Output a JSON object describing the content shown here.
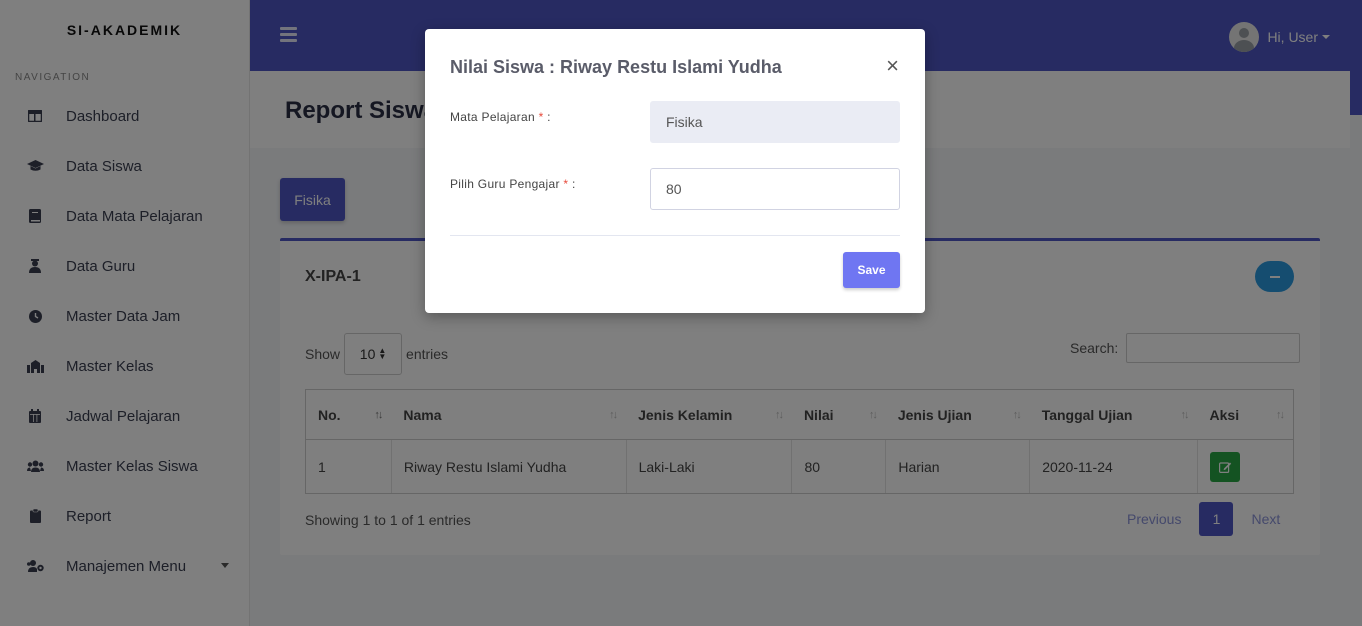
{
  "brand": "SI-AKADEMIK",
  "nav_heading": "NAVIGATION",
  "sidebar": {
    "items": [
      {
        "label": "Dashboard",
        "icon": "dashboard-icon"
      },
      {
        "label": "Data Siswa",
        "icon": "graduation-cap-icon"
      },
      {
        "label": "Data Mata Pelajaran",
        "icon": "book-icon"
      },
      {
        "label": "Data Guru",
        "icon": "teacher-icon"
      },
      {
        "label": "Master Data Jam",
        "icon": "clock-icon"
      },
      {
        "label": "Master Kelas",
        "icon": "school-icon"
      },
      {
        "label": "Jadwal Pelajaran",
        "icon": "calendar-icon"
      },
      {
        "label": "Master Kelas Siswa",
        "icon": "users-icon"
      },
      {
        "label": "Report",
        "icon": "clipboard-icon"
      },
      {
        "label": "Manajemen Menu",
        "icon": "users-cog-icon"
      }
    ]
  },
  "topbar": {
    "user_label": "Hi, User"
  },
  "page": {
    "title": "Report Siswa"
  },
  "subject_tab": "Fisika",
  "card": {
    "title": "X-IPA-1",
    "show_label": "Show",
    "entries_value": "10",
    "entries_label": "entries",
    "search_label": "Search:",
    "search_value": ""
  },
  "table": {
    "headers": [
      "No.",
      "Nama",
      "Jenis Kelamin",
      "Nilai",
      "Jenis Ujian",
      "Tanggal Ujian",
      "Aksi"
    ],
    "rows": [
      [
        "1",
        "Riway Restu Islami Yudha",
        "Laki-Laki",
        "80",
        "Harian",
        "2020-11-24"
      ]
    ]
  },
  "info_text": "Showing 1 to 1 of 1 entries",
  "pager": {
    "previous": "Previous",
    "current": "1",
    "next": "Next"
  },
  "modal": {
    "title": "Nilai Siswa : Riway Restu Islami Yudha",
    "close": "×",
    "field1_label": "Mata Pelajaran",
    "field1_value": "Fisika",
    "field2_label": "Pilih Guru Pengajar",
    "field2_value": "80",
    "required_mark": "*",
    "label_suffix": " :",
    "save_label": "Save"
  },
  "colors": {
    "accent": "#4e57c5",
    "success": "#28a745",
    "info": "#2b9ae0",
    "save": "#6f76f2"
  }
}
